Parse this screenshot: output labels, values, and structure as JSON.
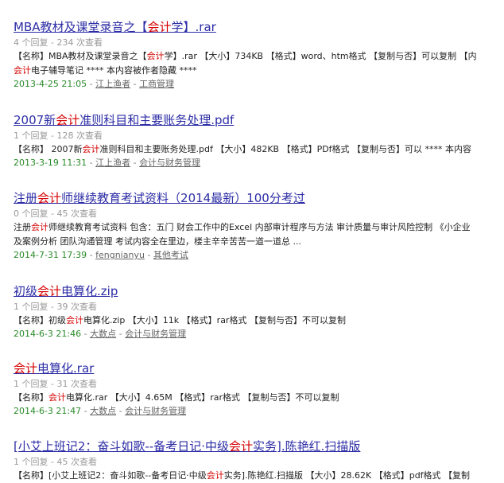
{
  "results": [
    {
      "title": [
        {
          "t": "MBA教材及课堂录音之【"
        },
        {
          "t": "会计",
          "hl": true
        },
        {
          "t": "学】.rar"
        }
      ],
      "stats": "4 个回复 - 234 次查看",
      "snippet": [
        [
          {
            "t": "【名称】MBA教材及课堂录音之【"
          },
          {
            "t": "会计",
            "hl": true
          },
          {
            "t": "学】.rar 【大小】734KB 【格式】word、htm格式 【复制与否】可以复制 【内"
          }
        ],
        [
          {
            "t": "会计",
            "hl": true
          },
          {
            "t": "电子辅导笔记 **** 本内容被作者隐藏 ****"
          }
        ]
      ],
      "date": "2013-4-25 21:05",
      "author": "江上渔者",
      "category": "工商管理"
    },
    {
      "title": [
        {
          "t": "2007新"
        },
        {
          "t": "会计",
          "hl": true
        },
        {
          "t": "准则科目和主要账务处理.pdf"
        }
      ],
      "stats": "1 个回复 - 128 次查看",
      "snippet": [
        [
          {
            "t": "【名称】 2007新"
          },
          {
            "t": "会计",
            "hl": true
          },
          {
            "t": "准则科目和主要账务处理.pdf 【大小】482KB 【格式】PDf格式 【复制与否】可以 **** 本内容"
          }
        ]
      ],
      "date": "2013-3-19 11:31",
      "author": "江上渔者",
      "category": "会计与财务管理"
    },
    {
      "title": [
        {
          "t": "注册"
        },
        {
          "t": "会计",
          "hl": true
        },
        {
          "t": "师继续教育考试资料（2014最新）100分考过"
        }
      ],
      "stats": "0 个回复 - 45 次查看",
      "snippet": [
        [
          {
            "t": "注册"
          },
          {
            "t": "会计",
            "hl": true
          },
          {
            "t": "师继续教育考试资料 包含：五门 财会工作中的Excel 内部审计程序与方法 审计质量与审计风险控制 《小企业"
          }
        ],
        [
          {
            "t": "及案例分析 团队沟通管理 考试内容全在里边，楼主辛辛苦苦一道一道总 ..."
          }
        ]
      ],
      "date": "2014-7-31 17:39",
      "author": "fengnianyu",
      "category": "其他考试"
    },
    {
      "title": [
        {
          "t": "初级"
        },
        {
          "t": "会计",
          "hl": true
        },
        {
          "t": "电算化.zip"
        }
      ],
      "stats": "1 个回复 - 39 次查看",
      "snippet": [
        [
          {
            "t": "【名称】初级"
          },
          {
            "t": "会计",
            "hl": true
          },
          {
            "t": "电算化.zip 【大小】11k 【格式】rar格式 【复制与否】不可以复制"
          }
        ]
      ],
      "date": "2014-6-3 21:46",
      "author": "大数点",
      "category": "会计与财务管理"
    },
    {
      "title": [
        {
          "t": "会计",
          "hl": true
        },
        {
          "t": "电算化.rar"
        }
      ],
      "stats": "1 个回复 - 31 次查看",
      "snippet": [
        [
          {
            "t": "【名称】"
          },
          {
            "t": "会计",
            "hl": true
          },
          {
            "t": "电算化.rar 【大小】4.65M 【格式】rar格式 【复制与否】不可以复制"
          }
        ]
      ],
      "date": "2014-6-3 21:47",
      "author": "大数点",
      "category": "会计与财务管理"
    },
    {
      "title": [
        {
          "t": "[小艾上班记2：奋斗如歌--备考日记·中级"
        },
        {
          "t": "会计",
          "hl": true
        },
        {
          "t": "实务].陈艳红.扫描版"
        }
      ],
      "stats": "1 个回复 - 45 次查看",
      "snippet": [
        [
          {
            "t": "【名称】[小艾上班记2：奋斗如歌--备考日记·中级"
          },
          {
            "t": "会计",
            "hl": true
          },
          {
            "t": "实务].陈艳红.扫描版 【大小】28.62K 【格式】pdf格式 【复制"
          }
        ]
      ],
      "date": "",
      "author": "",
      "category": ""
    }
  ]
}
